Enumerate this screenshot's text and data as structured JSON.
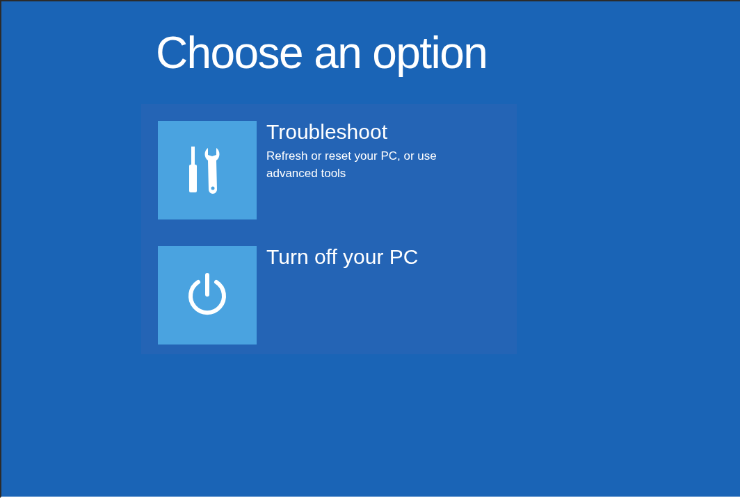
{
  "title": "Choose an option",
  "options": [
    {
      "kind": "tools",
      "label": "Troubleshoot",
      "description": "Refresh or reset your PC, or use advanced tools"
    },
    {
      "kind": "power",
      "label": "Turn off your PC"
    }
  ]
}
